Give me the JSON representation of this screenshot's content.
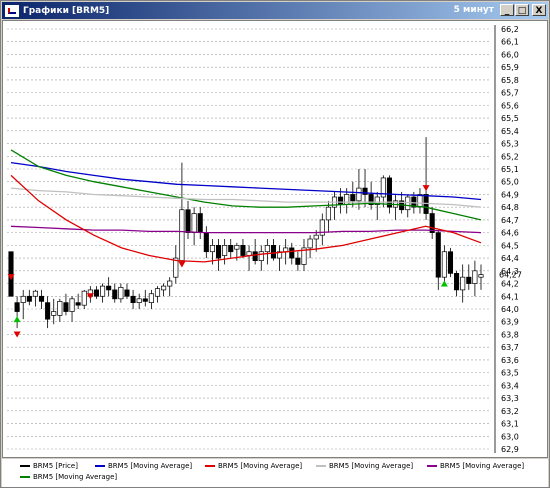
{
  "window": {
    "title": "Графики [BRM5]",
    "interval": "5 минут",
    "minimize": "_",
    "maximize": "□",
    "close": "X"
  },
  "legend": [
    {
      "label": "BRM5 [Price]",
      "color": "#000000"
    },
    {
      "label": "BRM5 [Moving Average]",
      "color": "#0000c8"
    },
    {
      "label": "BRM5 [Moving Average]",
      "color": "#e00000"
    },
    {
      "label": "BRM5 [Moving Average]",
      "color": "#c0c0c0"
    },
    {
      "label": "BRM5 [Moving Average]",
      "color": "#8b008b"
    },
    {
      "label": "BRM5 [Moving Average]",
      "color": "#008000"
    }
  ],
  "chart_data": {
    "type": "candlestick",
    "ylim": [
      62.9,
      66.2
    ],
    "yticks": [
      "66,2",
      "66,1",
      "66,0",
      "65,9",
      "65,8",
      "65,7",
      "65,6",
      "65,5",
      "65,4",
      "65,3",
      "65,2",
      "65,1",
      "65,0",
      "64,9",
      "64,8",
      "64,7",
      "64,6",
      "64,5",
      "64,4",
      "64,3",
      "64,2",
      "64,1",
      "64,0",
      "63,9",
      "63,8",
      "63,7",
      "63,6",
      "63,5",
      "63,4",
      "63,3",
      "63,2",
      "63,1",
      "63,0",
      "62,9"
    ],
    "last_price_label": "64,27",
    "last_price": 64.27,
    "grid": true,
    "candles": [
      {
        "o": 64.45,
        "h": 64.45,
        "l": 64.1,
        "c": 64.1
      },
      {
        "o": 64.05,
        "h": 64.1,
        "l": 63.85,
        "c": 63.98
      },
      {
        "o": 64.05,
        "h": 64.15,
        "l": 63.92,
        "c": 64.1
      },
      {
        "o": 64.1,
        "h": 64.15,
        "l": 64.03,
        "c": 64.06
      },
      {
        "o": 64.1,
        "h": 64.15,
        "l": 64.02,
        "c": 64.14
      },
      {
        "o": 64.1,
        "h": 64.15,
        "l": 64.0,
        "c": 64.06
      },
      {
        "o": 64.05,
        "h": 64.1,
        "l": 63.85,
        "c": 63.92
      },
      {
        "o": 63.95,
        "h": 64.08,
        "l": 63.88,
        "c": 63.98
      },
      {
        "o": 63.95,
        "h": 64.08,
        "l": 63.9,
        "c": 64.06
      },
      {
        "o": 64.05,
        "h": 64.12,
        "l": 63.95,
        "c": 63.98
      },
      {
        "o": 63.98,
        "h": 64.1,
        "l": 63.9,
        "c": 64.08
      },
      {
        "o": 64.05,
        "h": 64.12,
        "l": 64.0,
        "c": 64.03
      },
      {
        "o": 64.03,
        "h": 64.15,
        "l": 64.0,
        "c": 64.14
      },
      {
        "o": 64.1,
        "h": 64.18,
        "l": 64.05,
        "c": 64.15
      },
      {
        "o": 64.15,
        "h": 64.18,
        "l": 64.08,
        "c": 64.1
      },
      {
        "o": 64.1,
        "h": 64.2,
        "l": 64.05,
        "c": 64.18
      },
      {
        "o": 64.18,
        "h": 64.25,
        "l": 64.1,
        "c": 64.15
      },
      {
        "o": 64.15,
        "h": 64.2,
        "l": 64.05,
        "c": 64.08
      },
      {
        "o": 64.08,
        "h": 64.2,
        "l": 64.05,
        "c": 64.17
      },
      {
        "o": 64.15,
        "h": 64.2,
        "l": 64.08,
        "c": 64.1
      },
      {
        "o": 64.1,
        "h": 64.15,
        "l": 64.0,
        "c": 64.05
      },
      {
        "o": 64.05,
        "h": 64.12,
        "l": 64.0,
        "c": 64.08
      },
      {
        "o": 64.08,
        "h": 64.15,
        "l": 64.02,
        "c": 64.06
      },
      {
        "o": 64.05,
        "h": 64.15,
        "l": 64.0,
        "c": 64.12
      },
      {
        "o": 64.1,
        "h": 64.18,
        "l": 64.05,
        "c": 64.16
      },
      {
        "o": 64.15,
        "h": 64.2,
        "l": 64.1,
        "c": 64.18
      },
      {
        "o": 64.18,
        "h": 64.25,
        "l": 64.1,
        "c": 64.22
      },
      {
        "o": 64.25,
        "h": 64.5,
        "l": 64.2,
        "c": 64.4
      },
      {
        "o": 64.38,
        "h": 65.15,
        "l": 64.35,
        "c": 64.78
      },
      {
        "o": 64.78,
        "h": 64.85,
        "l": 64.55,
        "c": 64.6
      },
      {
        "o": 64.6,
        "h": 64.8,
        "l": 64.5,
        "c": 64.75
      },
      {
        "o": 64.75,
        "h": 64.8,
        "l": 64.55,
        "c": 64.6
      },
      {
        "o": 64.6,
        "h": 64.65,
        "l": 64.4,
        "c": 64.45
      },
      {
        "o": 64.45,
        "h": 64.55,
        "l": 64.35,
        "c": 64.5
      },
      {
        "o": 64.5,
        "h": 64.55,
        "l": 64.3,
        "c": 64.4
      },
      {
        "o": 64.42,
        "h": 64.55,
        "l": 64.35,
        "c": 64.5
      },
      {
        "o": 64.5,
        "h": 64.55,
        "l": 64.4,
        "c": 64.45
      },
      {
        "o": 64.47,
        "h": 64.52,
        "l": 64.38,
        "c": 64.5
      },
      {
        "o": 64.5,
        "h": 64.55,
        "l": 64.4,
        "c": 64.42
      },
      {
        "o": 64.42,
        "h": 64.5,
        "l": 64.3,
        "c": 64.45
      },
      {
        "o": 64.45,
        "h": 64.55,
        "l": 64.35,
        "c": 64.38
      },
      {
        "o": 64.38,
        "h": 64.5,
        "l": 64.3,
        "c": 64.45
      },
      {
        "o": 64.45,
        "h": 64.55,
        "l": 64.35,
        "c": 64.5
      },
      {
        "o": 64.5,
        "h": 64.55,
        "l": 64.38,
        "c": 64.4
      },
      {
        "o": 64.4,
        "h": 64.5,
        "l": 64.3,
        "c": 64.45
      },
      {
        "o": 64.45,
        "h": 64.55,
        "l": 64.35,
        "c": 64.48
      },
      {
        "o": 64.48,
        "h": 64.52,
        "l": 64.35,
        "c": 64.4
      },
      {
        "o": 64.4,
        "h": 64.45,
        "l": 64.3,
        "c": 64.35
      },
      {
        "o": 64.35,
        "h": 64.55,
        "l": 64.3,
        "c": 64.48
      },
      {
        "o": 64.48,
        "h": 64.58,
        "l": 64.4,
        "c": 64.55
      },
      {
        "o": 64.55,
        "h": 64.62,
        "l": 64.45,
        "c": 64.58
      },
      {
        "o": 64.58,
        "h": 64.75,
        "l": 64.5,
        "c": 64.7
      },
      {
        "o": 64.7,
        "h": 64.85,
        "l": 64.6,
        "c": 64.8
      },
      {
        "o": 64.8,
        "h": 64.92,
        "l": 64.7,
        "c": 64.88
      },
      {
        "o": 64.88,
        "h": 64.95,
        "l": 64.75,
        "c": 64.82
      },
      {
        "o": 64.82,
        "h": 64.95,
        "l": 64.75,
        "c": 64.9
      },
      {
        "o": 64.9,
        "h": 65.0,
        "l": 64.8,
        "c": 64.85
      },
      {
        "o": 64.85,
        "h": 65.1,
        "l": 64.78,
        "c": 64.95
      },
      {
        "o": 64.95,
        "h": 65.1,
        "l": 64.8,
        "c": 64.9
      },
      {
        "o": 64.9,
        "h": 65.0,
        "l": 64.78,
        "c": 64.82
      },
      {
        "o": 64.82,
        "h": 64.92,
        "l": 64.7,
        "c": 64.88
      },
      {
        "o": 64.88,
        "h": 65.05,
        "l": 64.8,
        "c": 65.03
      },
      {
        "o": 65.03,
        "h": 65.05,
        "l": 64.75,
        "c": 64.8
      },
      {
        "o": 64.8,
        "h": 64.9,
        "l": 64.7,
        "c": 64.85
      },
      {
        "o": 64.85,
        "h": 64.92,
        "l": 64.75,
        "c": 64.78
      },
      {
        "o": 64.78,
        "h": 64.9,
        "l": 64.72,
        "c": 64.88
      },
      {
        "o": 64.88,
        "h": 64.92,
        "l": 64.75,
        "c": 64.8
      },
      {
        "o": 64.8,
        "h": 64.95,
        "l": 64.75,
        "c": 64.9
      },
      {
        "o": 64.9,
        "h": 65.35,
        "l": 64.7,
        "c": 64.75
      },
      {
        "o": 64.75,
        "h": 64.8,
        "l": 64.55,
        "c": 64.6
      },
      {
        "o": 64.6,
        "h": 64.62,
        "l": 64.15,
        "c": 64.25
      },
      {
        "o": 64.25,
        "h": 64.5,
        "l": 64.2,
        "c": 64.45
      },
      {
        "o": 64.45,
        "h": 64.48,
        "l": 64.25,
        "c": 64.28
      },
      {
        "o": 64.28,
        "h": 64.3,
        "l": 64.1,
        "c": 64.15
      },
      {
        "o": 64.15,
        "h": 64.35,
        "l": 64.05,
        "c": 64.25
      },
      {
        "o": 64.25,
        "h": 64.35,
        "l": 64.15,
        "c": 64.2
      },
      {
        "o": 64.2,
        "h": 64.38,
        "l": 64.1,
        "c": 64.3
      },
      {
        "o": 64.25,
        "h": 64.35,
        "l": 64.15,
        "c": 64.27
      }
    ],
    "series": [
      {
        "color": "#0000c8",
        "values": [
          65.15,
          65.12,
          65.08,
          65.05,
          65.02,
          65.0,
          64.98,
          64.97,
          64.96,
          64.95,
          64.94,
          64.93,
          64.92,
          64.91,
          64.9,
          64.89,
          64.88,
          64.86
        ]
      },
      {
        "color": "#008000",
        "values": [
          65.25,
          65.12,
          65.05,
          65.0,
          64.96,
          64.92,
          64.88,
          64.84,
          64.81,
          64.8,
          64.8,
          64.81,
          64.82,
          64.83,
          64.82,
          64.8,
          64.75,
          64.7
        ]
      },
      {
        "color": "#c0c0c0",
        "values": [
          64.95,
          64.93,
          64.92,
          64.9,
          64.89,
          64.88,
          64.87,
          64.86,
          64.86,
          64.85,
          64.84,
          64.84,
          64.84,
          64.84,
          64.84,
          64.83,
          64.82,
          64.8
        ]
      },
      {
        "color": "#8b008b",
        "values": [
          64.65,
          64.64,
          64.63,
          64.62,
          64.62,
          64.61,
          64.61,
          64.6,
          64.6,
          64.6,
          64.6,
          64.6,
          64.61,
          64.61,
          64.62,
          64.62,
          64.61,
          64.6
        ]
      },
      {
        "color": "#e00000",
        "values": [
          65.05,
          64.85,
          64.7,
          64.58,
          64.48,
          64.42,
          64.38,
          64.37,
          64.4,
          64.43,
          64.45,
          64.47,
          64.5,
          64.55,
          64.6,
          64.65,
          64.6,
          64.52
        ]
      }
    ],
    "markers": [
      {
        "type": "sell",
        "candle": 0,
        "y": 64.25
      },
      {
        "type": "sell",
        "candle": 1,
        "y": 63.8
      },
      {
        "type": "buy",
        "candle": 1,
        "y": 63.92
      },
      {
        "type": "sell",
        "candle": 13,
        "y": 64.1
      },
      {
        "type": "sell",
        "candle": 28,
        "y": 64.35
      },
      {
        "type": "sell",
        "candle": 68,
        "y": 64.95
      },
      {
        "type": "buy",
        "candle": 71,
        "y": 64.2
      }
    ]
  }
}
